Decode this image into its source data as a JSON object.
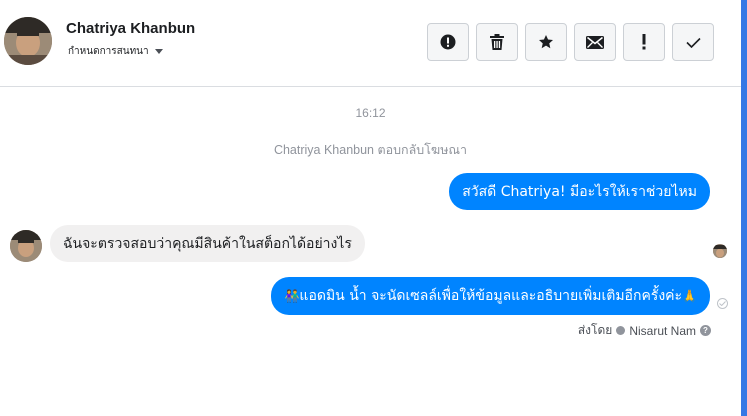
{
  "contact": {
    "name": "Chatriya Khanbun",
    "subtitle": "กำหนดการสนทนา"
  },
  "toolbar": {
    "buttons": [
      {
        "icon": "alert-circle-icon",
        "name": "report-button"
      },
      {
        "icon": "trash-icon",
        "name": "delete-button"
      },
      {
        "icon": "star-icon",
        "name": "star-button"
      },
      {
        "icon": "envelope-icon",
        "name": "mark-unread-button"
      },
      {
        "icon": "exclamation-icon",
        "name": "spam-button"
      },
      {
        "icon": "check-icon",
        "name": "done-button"
      }
    ]
  },
  "conversation": {
    "timestamp": "16:12",
    "system_message": "Chatriya Khanbun ตอบกลับโฆษณา",
    "messages": [
      {
        "direction": "out",
        "text": "สวัสดี Chatriya! มีอะไรให้เราช่วยไหม"
      },
      {
        "direction": "in",
        "text": "ฉันจะตรวจสอบว่าคุณมีสินค้าในสต็อกได้อย่างไร"
      },
      {
        "direction": "out",
        "emoji_start": "👫",
        "text": "แอดมิน น้ำ จะนัดเซลล์เพื่อให้ข้อมูลและอธิบายเพิ่มเติมอีกครั้งค่ะ",
        "emoji_end": "🙏"
      }
    ],
    "sent_by_label": "ส่งโดย",
    "sent_by_name": "Nisarut Nam"
  },
  "colors": {
    "outgoing_bubble": "#0084ff",
    "incoming_bubble": "#f1f0f0",
    "scrollbar": "#3578e5"
  }
}
